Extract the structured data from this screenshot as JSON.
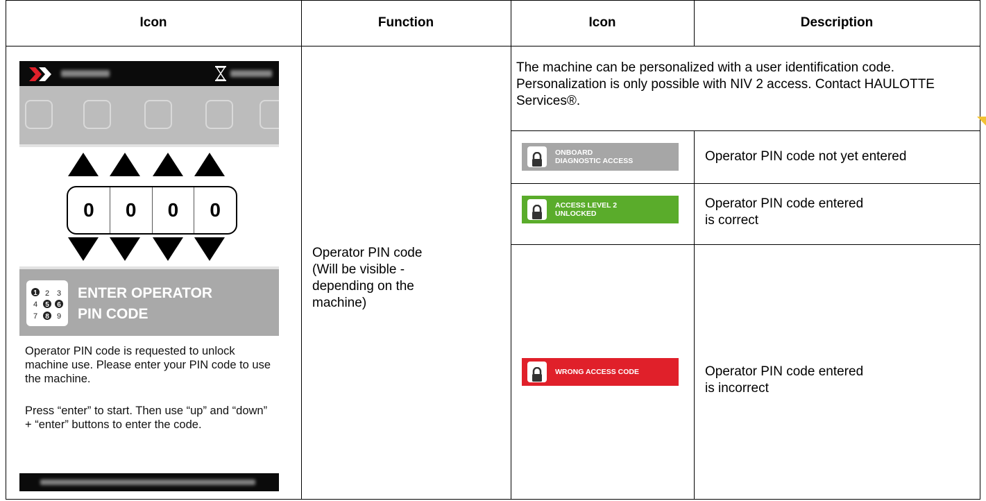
{
  "headers": [
    "Icon",
    "Function",
    "Icon",
    "Description"
  ],
  "function_text": "Operator PIN code (Will be visible - depending on the machine)",
  "intro_text": "The machine can be personalized with a user identification code. Personalization is only possible with  NIV 2 access. Contact HAULOTTE Services®.",
  "device": {
    "pin_digits": [
      "0",
      "0",
      "0",
      "0"
    ],
    "enter_title_line1": "ENTER OPERATOR",
    "enter_title_line2": "PIN CODE",
    "keypad_digits": "1 2 3 4 5 6 7 8 9",
    "message1": "Operator PIN code is requested to unlock machine use. Please enter your PIN code to use the machine.",
    "message2": "Press “enter” to start. Then use “up” and “down” + “enter” buttons to enter the code."
  },
  "rows": [
    {
      "badge_line1": "ONBOARD",
      "badge_line2": "DIAGNOSTIC ACCESS",
      "badge_color": "#a6a6a6",
      "description": "Operator PIN code not yet entered"
    },
    {
      "badge_line1": "ACCESS LEVEL 2",
      "badge_line2": "UNLOCKED",
      "badge_color": "#5aac2b",
      "description": "Operator PIN code entered is correct"
    },
    {
      "badge_line1": "WRONG ACCESS CODE",
      "badge_line2": "",
      "badge_color": "#e0202a",
      "description": "Operator PIN code entered is incorrect"
    }
  ],
  "colors": {
    "accent_yellow": "#f2c233"
  }
}
